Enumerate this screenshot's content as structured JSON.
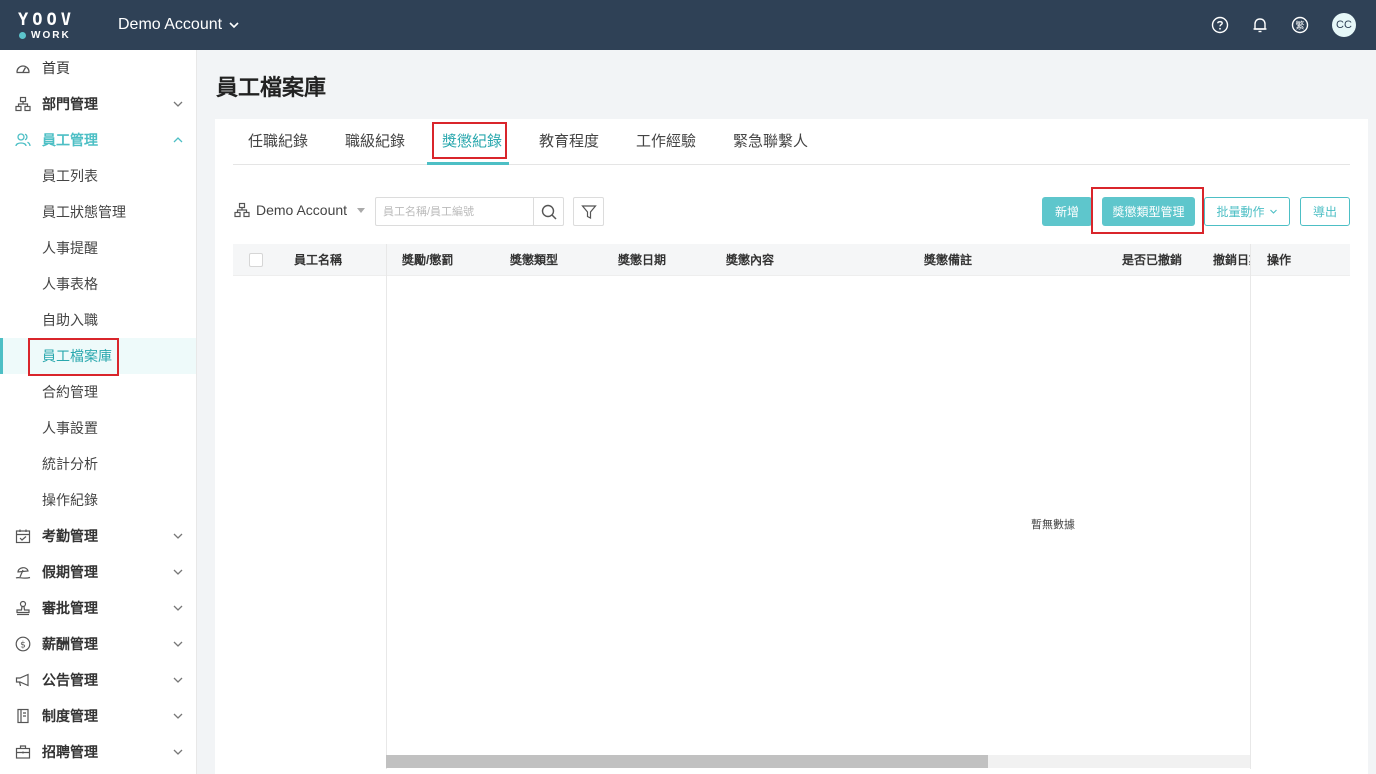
{
  "header": {
    "logo_top": "YOOV",
    "logo_bottom": "WORK",
    "account": "Demo Account",
    "avatar": "CC",
    "lang_icon_text": "繁"
  },
  "sidebar": {
    "items": [
      {
        "label": "首頁",
        "icon": "dashboard-icon"
      },
      {
        "label": "部門管理",
        "icon": "org-icon"
      },
      {
        "label": "員工管理",
        "icon": "users-icon"
      },
      {
        "label": "考勤管理",
        "icon": "calendar-icon"
      },
      {
        "label": "假期管理",
        "icon": "beach-icon"
      },
      {
        "label": "審批管理",
        "icon": "stamp-icon"
      },
      {
        "label": "薪酬管理",
        "icon": "dollar-icon"
      },
      {
        "label": "公告管理",
        "icon": "megaphone-icon"
      },
      {
        "label": "制度管理",
        "icon": "book-icon"
      },
      {
        "label": "招聘管理",
        "icon": "briefcase-icon"
      }
    ],
    "sub_items": [
      "員工列表",
      "員工狀態管理",
      "人事提醒",
      "人事表格",
      "自助入職",
      "員工檔案庫",
      "合約管理",
      "人事設置",
      "統計分析",
      "操作紀錄"
    ]
  },
  "main": {
    "title": "員工檔案庫",
    "tabs": [
      "任職紀錄",
      "職級紀錄",
      "獎懲紀錄",
      "教育程度",
      "工作經驗",
      "緊急聯繫人"
    ],
    "org_select": "Demo Account",
    "search_placeholder": "員工名稱/員工編號",
    "buttons": {
      "add": "新增",
      "type_manage": "獎懲類型管理",
      "batch": "批量動作",
      "export": "導出"
    },
    "columns": [
      "員工名稱",
      "獎勵/懲罰",
      "獎懲類型",
      "獎懲日期",
      "獎懲內容",
      "獎懲備註",
      "是否已撤銷",
      "撤銷日期",
      "操作"
    ],
    "empty_text": "暫無數據"
  },
  "colors": {
    "topbar": "#2f4156",
    "accent": "#4dbfc5",
    "highlight_box": "#d9252b"
  }
}
